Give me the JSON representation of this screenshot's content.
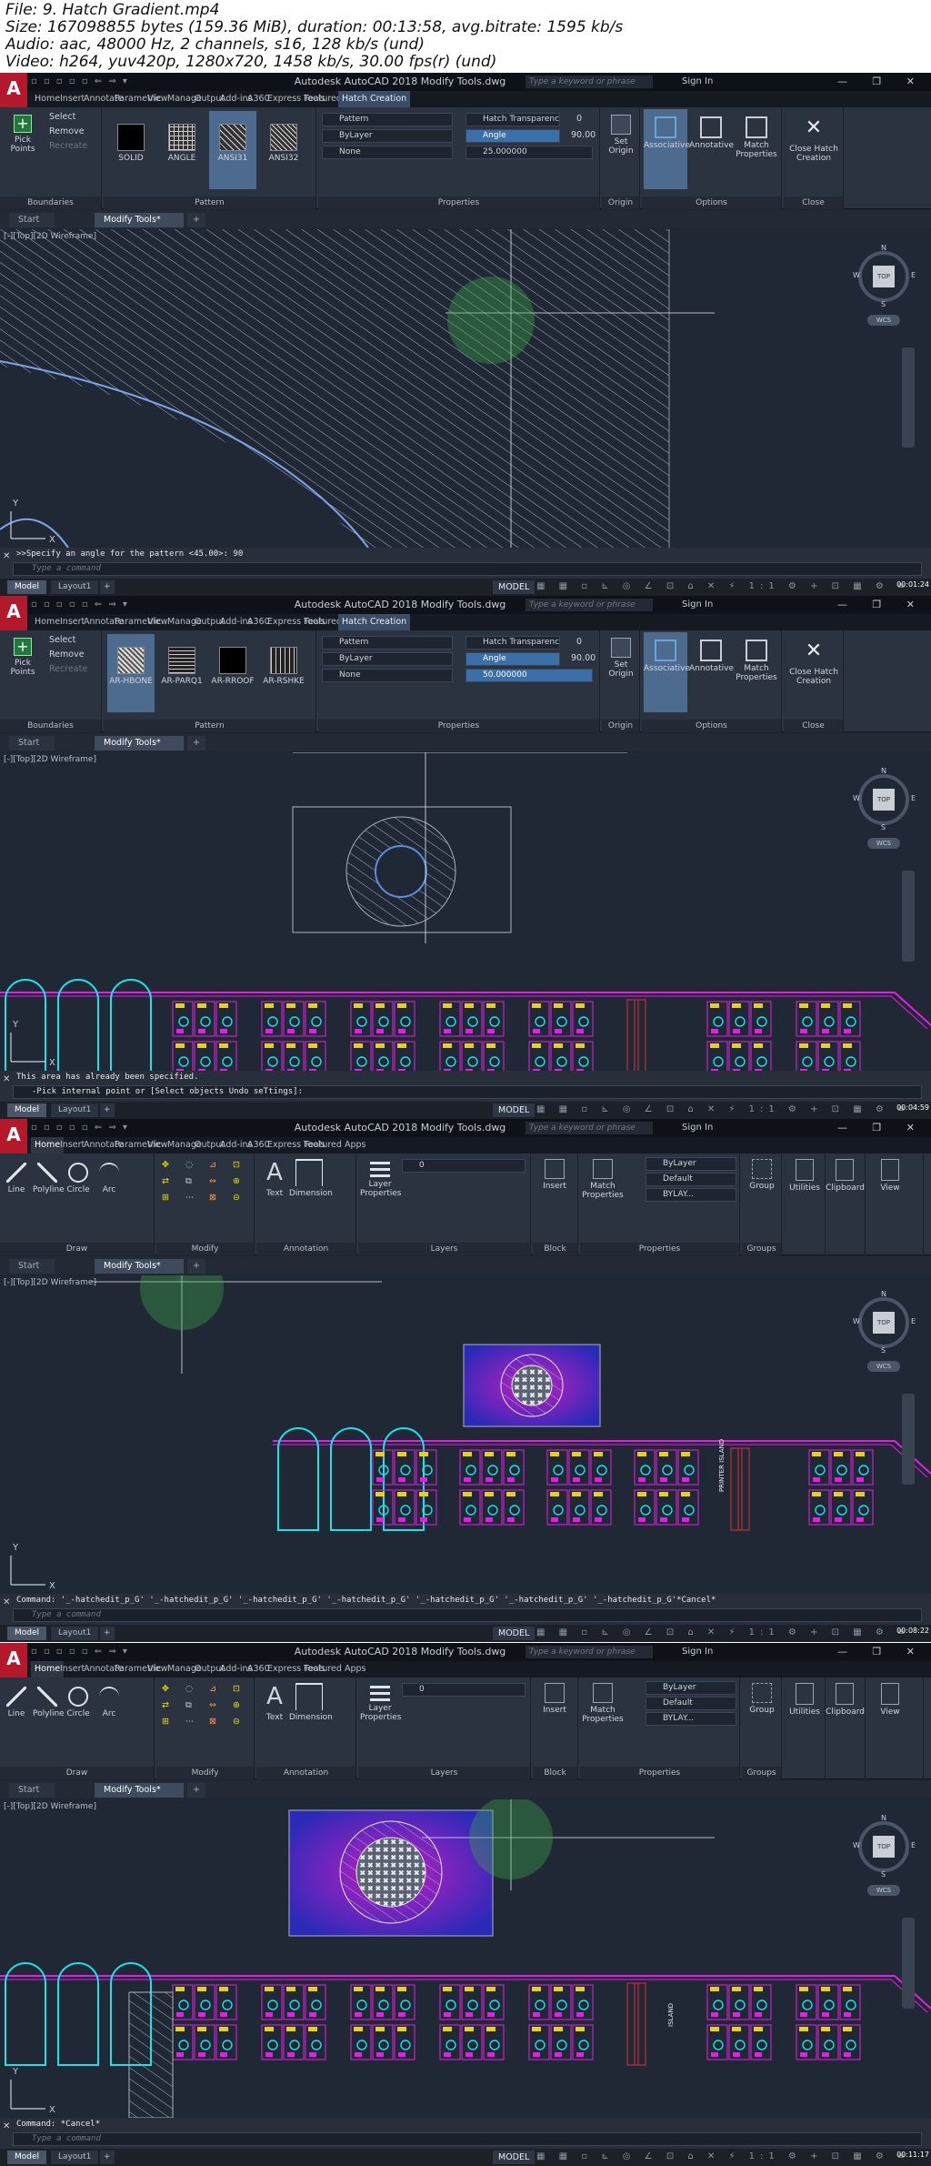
{
  "file_info": {
    "line1": "File: 9. Hatch Gradient.mp4",
    "line2": "Size: 167098855 bytes (159.36 MiB), duration: 00:13:58, avg.bitrate: 1595 kb/s",
    "line3": "Audio: aac, 48000 Hz, 2 channels, s16, 128 kb/s (und)",
    "line4": "Video: h264, yuv420p, 1280x720, 1458 kb/s, 30.00 fps(r) (und)"
  },
  "app": {
    "title": "Autodesk AutoCAD 2018   Modify Tools.dwg",
    "search_placeholder": "Type a keyword or phrase",
    "sign_in": "Sign In",
    "logo": "A",
    "qat": "▫ ▫ ▫ ▫ ▫ ⇐ ⇒ ▾",
    "window_controls": "— ❐ ✕",
    "ribbon_tabs": [
      "Home",
      "Insert",
      "Annotate",
      "Parametric",
      "View",
      "Manage",
      "Output",
      "Add-ins",
      "A360",
      "Express Tools",
      "Featured Apps"
    ],
    "context_tab": "Hatch Creation",
    "doc_tabs": {
      "start": "Start",
      "active": "Modify Tools*",
      "plus": "+"
    },
    "layout_tabs": {
      "model": "Model",
      "layout1": "Layout1",
      "plus": "+"
    },
    "status_model": "MODEL",
    "status_icons": "▦ ▦ ▫ ⊾ ◎ ∠ ⊡ ⌂ ✕ ⚡ 1:1 ⚙ + ⊡ ▦ ⚙ ≡"
  },
  "hatch_ribbon": {
    "boundaries": {
      "pick_points": "Pick Points",
      "select": "Select",
      "remove": "Remove",
      "recreate": "Recreate",
      "label": "Boundaries"
    },
    "pattern_label": "Pattern",
    "properties": {
      "pattern_type": "Pattern",
      "hatch_transparency": "Hatch Transparency",
      "transparency_value": "0",
      "color": "ByLayer",
      "angle_label": "Angle",
      "angle_value": "90.00",
      "background": "None",
      "label": "Properties"
    },
    "origin": {
      "set_origin": "Set Origin",
      "label": "Origin"
    },
    "options": {
      "associative": "Associative",
      "annotative": "Annotative",
      "match_properties": "Match Properties",
      "label": "Options"
    },
    "close": {
      "close": "Close Hatch Creation",
      "label": "Close"
    }
  },
  "home_ribbon": {
    "draw": {
      "line": "Line",
      "polyline": "Polyline",
      "circle": "Circle",
      "arc": "Arc",
      "label": "Draw"
    },
    "modify_label": "Modify",
    "annotation": {
      "text": "Text",
      "dimension": "Dimension",
      "label": "Annotation"
    },
    "layers": {
      "layer_properties": "Layer Properties",
      "current_layer": "0",
      "label": "Layers"
    },
    "block": {
      "insert": "Insert",
      "label": "Block"
    },
    "properties": {
      "match": "Match Properties",
      "color": "ByLayer",
      "linetype": "Default",
      "lineweight": "BYLAY...",
      "label": "Properties"
    },
    "groups": {
      "group": "Group",
      "label": "Groups"
    },
    "utilities": "Utilities",
    "clipboard": "Clipboard",
    "view": "View"
  },
  "viewcube": {
    "top": "TOP",
    "n": "N",
    "s": "S",
    "w": "W",
    "e": "E",
    "wcs": "WCS"
  },
  "frames": [
    {
      "viewport_label": "[-][Top][2D Wireframe]",
      "patterns": [
        "SOLID",
        "ANGLE",
        "ANSI31",
        "ANSI32"
      ],
      "selected_pattern": "ANSI31",
      "scale_value": "25.000000",
      "cmd_history": ">>Specify an angle for the pattern <45.00>: 90",
      "cmd_input": "Type a command",
      "timer": "00:01:24"
    },
    {
      "viewport_label": "[-][Top][2D Wireframe]",
      "patterns": [
        "AR-HBONE",
        "AR-PARQ1",
        "AR-RROOF",
        "AR-RSHKE"
      ],
      "selected_pattern": "AR-HBONE",
      "scale_value": "50.000000",
      "cmd_history": "This area has already been specified.",
      "cmd_input": "-Pick internal point or [Select objects Undo seTtings]:",
      "timer": "00:04:59"
    },
    {
      "viewport_label": "[-][Top][2D Wireframe]",
      "cmd_history": "Command: '_-hatchedit_p_G' '_-hatchedit_p_G' '_-hatchedit_p_G' '_-hatchedit_p_G' '_-hatchedit_p_G' '_-hatchedit_p_G' '_-hatchedit_p_G'*Cancel*",
      "cmd_input": "Type a command",
      "timer": "00:08:22",
      "island_label": "PRINTER ISLAND"
    },
    {
      "viewport_label": "[-][Top][2D Wireframe]",
      "cmd_history": "Command: *Cancel*",
      "cmd_input": "Type a command",
      "timer": "00:11:17",
      "island_label": "ISLAND"
    }
  ],
  "colors": {
    "canvas": "#212835",
    "ribbon": "#2b3240",
    "accent_blue": "#4d6a8f",
    "cad_cyan": "#19e3e8",
    "cad_magenta": "#e51ee5",
    "cad_yellow": "#e5d21a",
    "cad_red": "#e0303a",
    "gradient_blue": "#2a2ab8",
    "gradient_magenta": "#c21fc2"
  }
}
